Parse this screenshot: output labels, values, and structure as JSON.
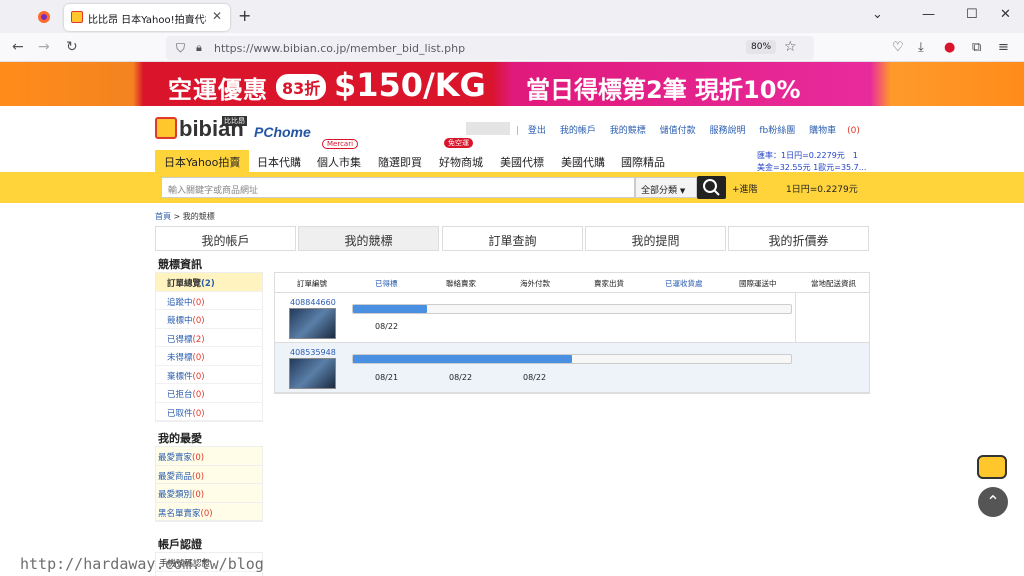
{
  "browser": {
    "tab_title": "比比昂 日本Yahoo!拍賣代標 | 日",
    "url": "https://www.bibian.co.jp/member_bid_list.php",
    "zoom": "80%"
  },
  "banner": {
    "left_text": "空運優惠",
    "discount": "83折",
    "price": "$150/KG",
    "right_text": "當日得標第2筆 現折10%"
  },
  "header": {
    "logo_text": "bibian",
    "logo_tag": "比比昂",
    "partner": "PChome",
    "links": [
      "登出",
      "我的帳戶",
      "我的競標",
      "儲值付款",
      "服務說明",
      "fb粉絲團",
      "購物車"
    ],
    "cart_count": "(0)",
    "nav": [
      "日本Yahoo拍賣",
      "日本代購",
      "個人市集",
      "隨選即買",
      "好物商城",
      "美國代標",
      "美國代購",
      "國際精品"
    ],
    "badge_mercari": "Mercari",
    "badge_free": "免空運",
    "rate_line1": "匯率：1日円=0.2279元　1",
    "rate_line2": "美金=32.55元 1歐元=35.7..."
  },
  "search": {
    "placeholder": "輸入關鍵字或商品網址",
    "category": "全部分類",
    "advanced": "+進階",
    "rate": "1日円=0.2279元"
  },
  "breadcrumb": {
    "home": "首頁",
    "current": "> 我的競標"
  },
  "page_tabs": [
    "我的帳戶",
    "我的競標",
    "訂單查詢",
    "我的提問",
    "我的折價券"
  ],
  "sidebar": {
    "bid_title": "競標資訊",
    "bid_items": [
      {
        "label": "訂單總覽",
        "count": "(2)"
      },
      {
        "label": "追蹤中",
        "count": "(0)"
      },
      {
        "label": "競標中",
        "count": "(0)"
      },
      {
        "label": "已得標",
        "count": "(2)"
      },
      {
        "label": "未得標",
        "count": "(0)"
      },
      {
        "label": "棄標件",
        "count": "(0)"
      },
      {
        "label": "已拒台",
        "count": "(0)"
      },
      {
        "label": "已取件",
        "count": "(0)"
      }
    ],
    "fav_title": "我的最愛",
    "fav_items": [
      {
        "label": "最愛賣家",
        "count": "(0)"
      },
      {
        "label": "最愛商品",
        "count": "(0)"
      },
      {
        "label": "最愛類別",
        "count": "(0)"
      },
      {
        "label": "黑名單賣家",
        "count": "(0)"
      }
    ],
    "account_title": "帳戶認證",
    "account_item": "手機號碼認證"
  },
  "table": {
    "headers": [
      "訂單編號",
      "已得標",
      "聯絡賣家",
      "海外付款",
      "賣家出貨",
      "已運收貨處",
      "國際運送中",
      "當地配送資訊"
    ],
    "rows": [
      {
        "order_no": "408844660",
        "progress": 0.17,
        "dates": [
          "08/22"
        ]
      },
      {
        "order_no": "408535948",
        "progress": 0.5,
        "dates": [
          "08/21",
          "08/22",
          "08/22"
        ]
      }
    ]
  },
  "watermark": "http://hardaway.com.tw/blog"
}
